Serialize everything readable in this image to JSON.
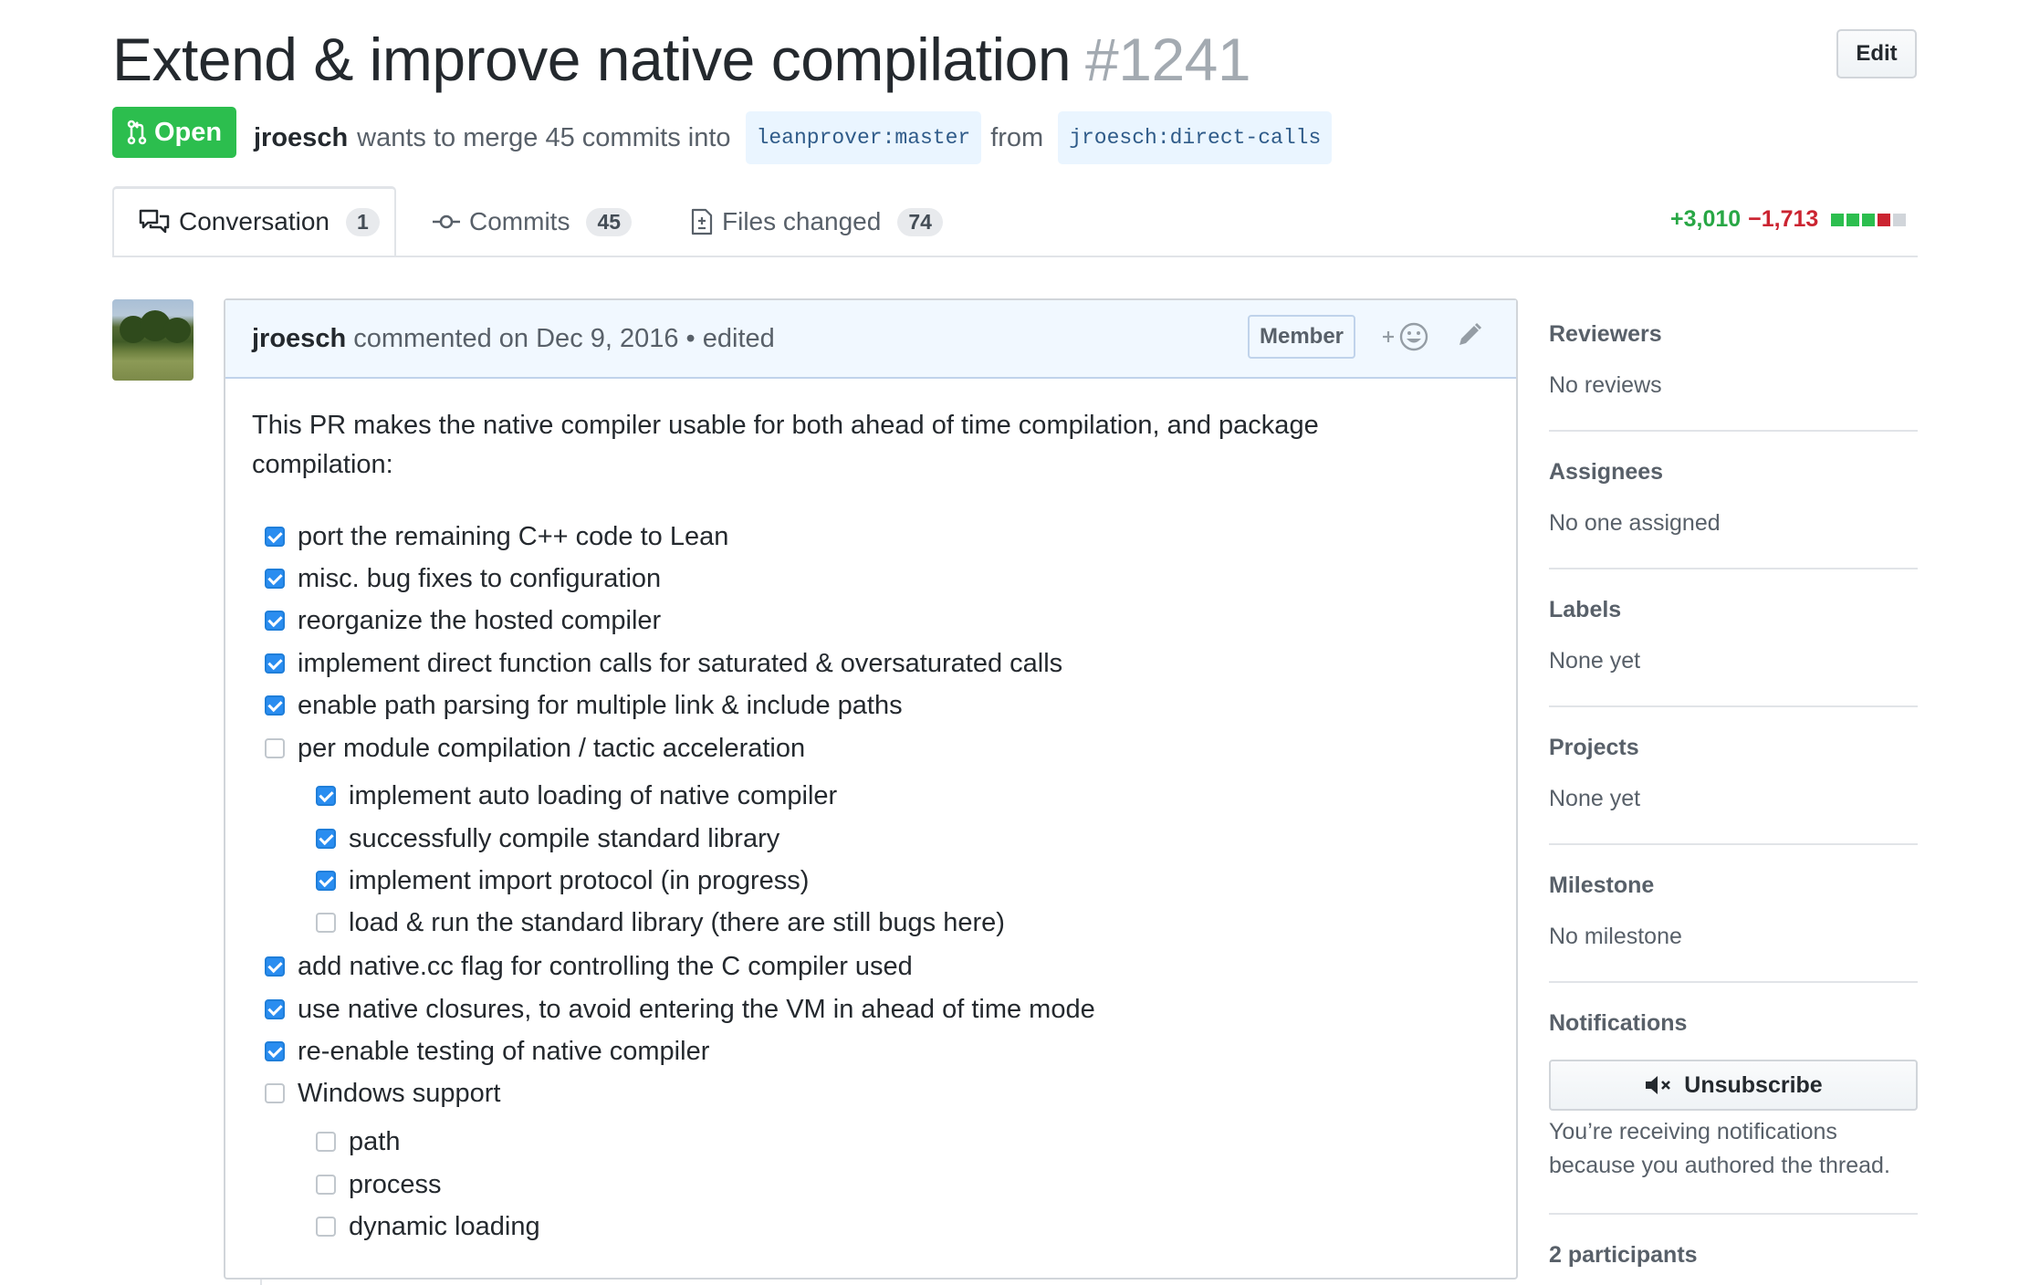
{
  "header": {
    "title": "Extend & improve native compilation",
    "number": "#1241",
    "edit_label": "Edit",
    "state_label": "Open",
    "author": "jroesch",
    "merge_text": "wants to merge 45 commits into",
    "base_branch": "leanprover:master",
    "from_text": "from",
    "head_branch": "jroesch:direct-calls"
  },
  "tabs": [
    {
      "label": "Conversation",
      "count": "1",
      "icon": "comment-discussion-icon"
    },
    {
      "label": "Commits",
      "count": "45",
      "icon": "git-commit-icon"
    },
    {
      "label": "Files changed",
      "count": "74",
      "icon": "file-diff-icon"
    }
  ],
  "diffstat": {
    "additions": "+3,010",
    "deletions": "−1,713",
    "add_color": "#28a745",
    "del_color": "#cb2431"
  },
  "comment": {
    "author": "jroesch",
    "meta": "commented on Dec 9, 2016 • edited",
    "role_badge": "Member",
    "body": "This PR makes the native compiler usable for both ahead of time compilation, and package compilation:",
    "tasks": [
      {
        "text": "port the remaining C++ code to Lean",
        "checked": true
      },
      {
        "text": "misc. bug fixes to configuration",
        "checked": true
      },
      {
        "text": "reorganize the hosted compiler",
        "checked": true
      },
      {
        "text": "implement direct function calls for saturated & oversaturated calls",
        "checked": true
      },
      {
        "text": "enable path parsing for multiple link & include paths",
        "checked": true
      },
      {
        "text": "per module compilation / tactic acceleration",
        "checked": false
      },
      {
        "text": "implement auto loading of native compiler",
        "checked": true
      },
      {
        "text": "successfully compile standard library",
        "checked": true
      },
      {
        "text": "implement import protocol (in progress)",
        "checked": true
      },
      {
        "text": "load & run the standard library (there are still bugs here)",
        "checked": false
      },
      {
        "text": "add native.cc flag for controlling the C compiler used",
        "checked": true
      },
      {
        "text": "use native closures, to avoid entering the VM in ahead of time mode",
        "checked": true
      },
      {
        "text": "re-enable testing of native compiler",
        "checked": true
      },
      {
        "text": "Windows support",
        "checked": false
      },
      {
        "text": "path",
        "checked": false
      },
      {
        "text": "process",
        "checked": false
      },
      {
        "text": "dynamic loading",
        "checked": false
      }
    ],
    "check_color": "#2a8df0"
  },
  "sidebar": {
    "reviewers": {
      "heading": "Reviewers",
      "value": "No reviews"
    },
    "assignees": {
      "heading": "Assignees",
      "value": "No one assigned"
    },
    "labels": {
      "heading": "Labels",
      "value": "None yet"
    },
    "projects": {
      "heading": "Projects",
      "value": "None yet"
    },
    "milestone": {
      "heading": "Milestone",
      "value": "No milestone"
    },
    "notifications": {
      "heading": "Notifications",
      "button_label": "Unsubscribe",
      "note": "You’re receiving notifications because you authored the thread."
    },
    "participants": "2 participants"
  },
  "colors": {
    "open_green": "#2cbe4e",
    "link_blue": "#0366d6"
  }
}
